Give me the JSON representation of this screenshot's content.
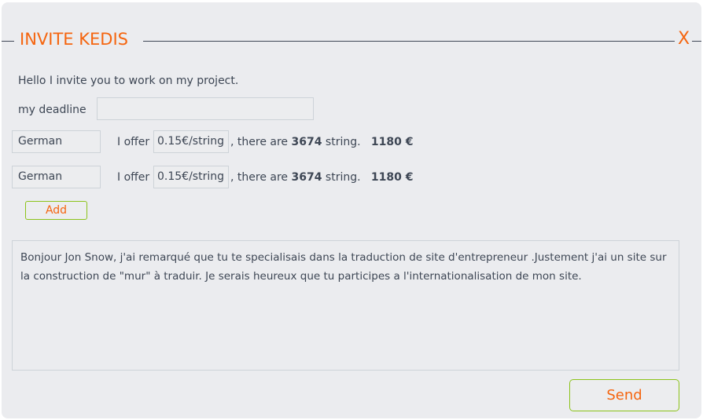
{
  "dialog": {
    "title": "INVITE KEDIS",
    "close_label": "X",
    "intro": "Hello I invite you to work on my project.",
    "deadline_label": "my deadline",
    "deadline_value": "",
    "rows": [
      {
        "language": "German",
        "offer_label": "I offer",
        "price": "0.15€/string",
        "sep": ",",
        "there_are": "there are",
        "count": "3674",
        "unit": "string.",
        "total": "1180 €"
      },
      {
        "language": "German",
        "offer_label": "I offer",
        "price": "0.15€/string",
        "sep": ",",
        "there_are": "there are",
        "count": "3674",
        "unit": "string.",
        "total": "1180 €"
      }
    ],
    "add_label": "Add",
    "message": "Bonjour Jon Snow, j'ai remarqué que tu te specialisais dans la traduction de site d'entrepreneur .Justement j'ai un site sur la construction de \"mur\" à traduir. Je serais heureux que tu participes a l'internationalisation de mon site.",
    "send_label": "Send"
  },
  "colors": {
    "accent": "#f5650f",
    "button_border": "#8cc31a",
    "panel": "#ebecef"
  }
}
